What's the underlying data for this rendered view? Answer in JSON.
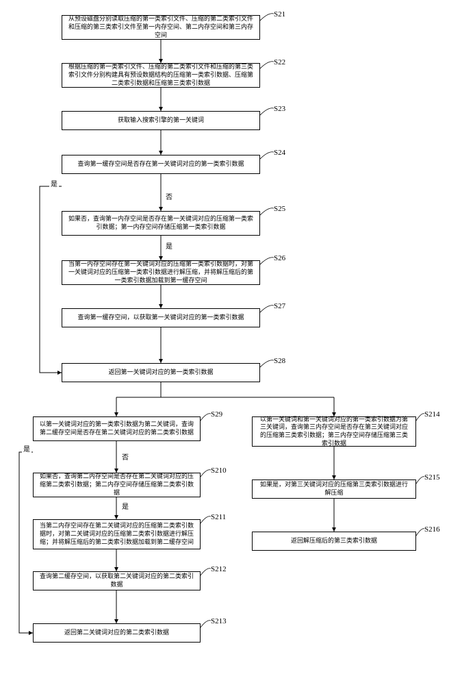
{
  "steps": {
    "s21": {
      "label": "S21",
      "text": "从预设磁盘分别读取压缩的第一类索引文件、压缩的第二类索引文件和压缩的第三类索引文件至第一内存空间、第二内存空间和第三内存空间"
    },
    "s22": {
      "label": "S22",
      "text": "根据压缩的第一类索引文件、压缩的第二类索引文件和压缩的第三类索引文件分别构建具有预设数据结构的压缩第一类索引数据、压缩第二类索引数据和压缩第三类索引数据"
    },
    "s23": {
      "label": "S23",
      "text": "获取输入搜索引擎的第一关键词"
    },
    "s24": {
      "label": "S24",
      "text": "查询第一缓存空间是否存在第一关键词对应的第一类索引数据"
    },
    "s25": {
      "label": "S25",
      "text": "如果否，查询第一内存空间是否存在第一关键词对应的压缩第一类索引数据；第一内存空间存储压缩第一类索引数据"
    },
    "s26": {
      "label": "S26",
      "text": "当第一内存空间存在第一关键词对应的压缩第一类索引数据时，对第一关键词对应的压缩第一类索引数据进行解压缩，并将解压缩后的第一类索引数据加载到第一缓存空间"
    },
    "s27": {
      "label": "S27",
      "text": "查询第一缓存空间，以获取第一关键词对应的第一类索引数据"
    },
    "s28": {
      "label": "S28",
      "text": "返回第一关键词对应的第一类索引数据"
    },
    "s29": {
      "label": "S29",
      "text": "以第一关键词对应的第一类索引数据为第二关键词，查询第二缓存空间是否存在第二关键词对应的第二类索引数据"
    },
    "s210": {
      "label": "S210",
      "text": "如果否，查询第二内存空间是否存在第二关键词对应的压缩第二类索引数据；第二内存空间存储压缩第二类索引数据"
    },
    "s211": {
      "label": "S211",
      "text": "当第二内存空间存在第二关键词对应的压缩第二类索引数据时，对第二关键词对应的压缩第二类索引数据进行解压缩；并将解压缩后的第二类索引数据加载到第二缓存空间"
    },
    "s212": {
      "label": "S212",
      "text": "查询第二缓存空间，以获取第二关键词对应的第二类索引数据"
    },
    "s213": {
      "label": "S213",
      "text": "返回第二关键词对应的第二类索引数据"
    },
    "s214": {
      "label": "S214",
      "text": "以第一关键词和第一关键词对应的第一类索引数据为第三关键词，查询第三内存空间是否存在第三关键词对应的压缩第三类索引数据；第三内存空间存储压缩第三类索引数据"
    },
    "s215": {
      "label": "S215",
      "text": "如果是，对第三关键词对应的压缩第三类索引数据进行解压缩"
    },
    "s216": {
      "label": "S216",
      "text": "返回解压缩后的第三类索引数据"
    }
  },
  "edges": {
    "yes": "是",
    "no": "否"
  }
}
